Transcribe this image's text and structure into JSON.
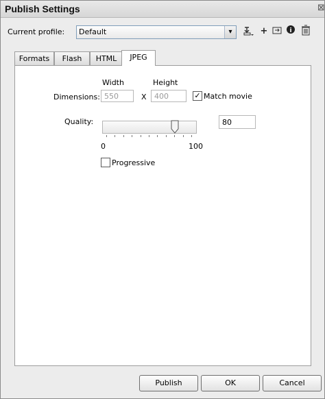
{
  "window": {
    "title": "Publish Settings"
  },
  "profile": {
    "label": "Current profile:",
    "value": "Default",
    "tool_icons": [
      "import-export-icon",
      "add-profile-icon",
      "duplicate-icon",
      "info-icon",
      "trash-icon"
    ]
  },
  "tabs": [
    {
      "label": "Formats",
      "active": false
    },
    {
      "label": "Flash",
      "active": false
    },
    {
      "label": "HTML",
      "active": false
    },
    {
      "label": "JPEG",
      "active": true
    }
  ],
  "jpeg": {
    "width_header": "Width",
    "height_header": "Height",
    "dimensions_label": "Dimensions:",
    "width_value": "550",
    "x_separator": "X",
    "height_value": "400",
    "match_movie_label": "Match movie",
    "match_movie_checked": true,
    "quality_label": "Quality:",
    "quality_value": "80",
    "slider_min_label": "0",
    "slider_max_label": "100",
    "slider_level": 0.8,
    "progressive_label": "Progressive",
    "progressive_checked": false
  },
  "buttons": {
    "publish": "Publish",
    "ok": "OK",
    "cancel": "Cancel"
  }
}
